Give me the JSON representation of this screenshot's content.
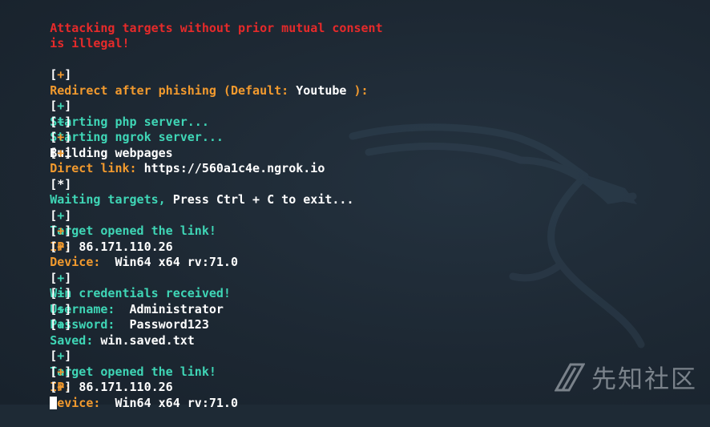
{
  "warning": {
    "line1": "Attacking targets without prior mutual consent",
    "line2": "is illegal!"
  },
  "markers": {
    "left": "[",
    "right": "]",
    "plus": "+",
    "star": "*"
  },
  "redirect": {
    "label": "Redirect after phishing (Default: ",
    "value": "Youtube",
    "suffix": " ):"
  },
  "startup": {
    "php": "Starting php server...",
    "ngrok": "Starting ngrok server...",
    "build": "Building webpages",
    "direct_label": "Direct link: ",
    "direct_value": "https://560a1c4e.ngrok.io"
  },
  "waiting": {
    "label": "Waiting targets, ",
    "value": "Press Ctrl + C to exit..."
  },
  "events": [
    {
      "opened": "Target opened the link!",
      "ip_label": "IP: ",
      "ip_value": "86.171.110.26",
      "device_label": "Device:  ",
      "device_value": "Win64 x64 rv:71.0"
    },
    {
      "opened": "Target opened the link!",
      "ip_label": "IP: ",
      "ip_value": "86.171.110.26",
      "device_label": "Device:  ",
      "device_value": "Win64 x64 rv:71.0"
    }
  ],
  "credentials": {
    "received": "Win credentials received!",
    "username_label": "Username:  ",
    "username_value": "Administrator",
    "password_label": "Password:  ",
    "password_value": "Password123",
    "saved_label": "Saved: ",
    "saved_value": "win.saved.txt"
  },
  "watermark": {
    "text": "先知社区",
    "icon": "xianzhi-logo-icon"
  },
  "colors": {
    "background": "#1e2a35",
    "warning": "#e62a2a",
    "orange": "#f29a2e",
    "teal": "#3fd6b6",
    "white": "#ffffff"
  }
}
